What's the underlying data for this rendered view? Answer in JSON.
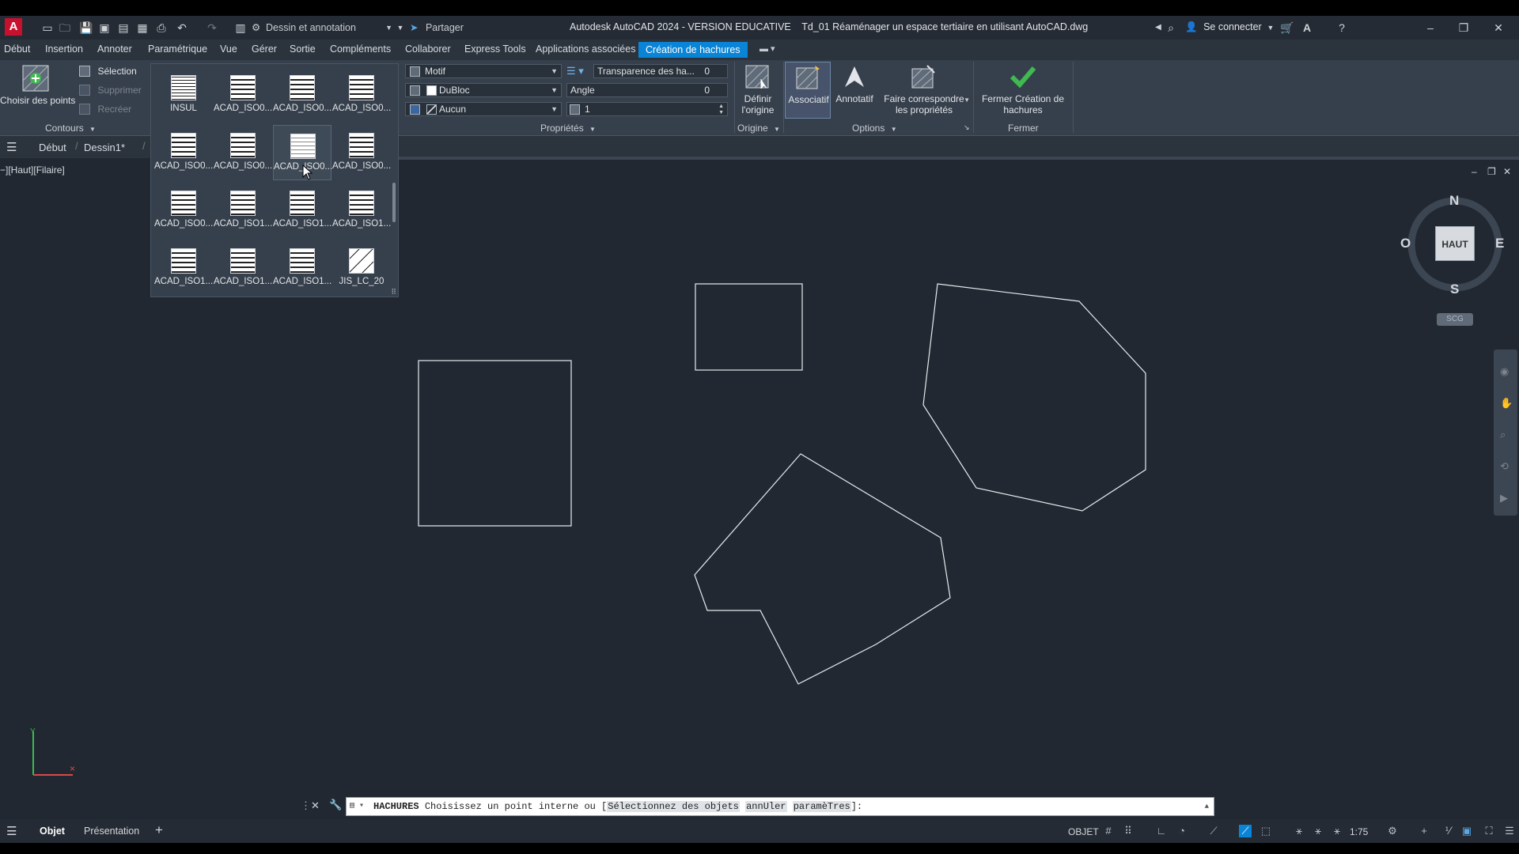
{
  "app": {
    "title": "Autodesk AutoCAD 2024 - VERSION EDUCATIVE",
    "filename": "Td_01 Réaménager un espace tertiaire en utilisant AutoCAD.dwg",
    "logo": "A",
    "workspace": "Dessin et annotation",
    "share_label": "Partager",
    "signin_label": "Se connecter"
  },
  "menu": {
    "items": [
      "Début",
      "Insertion",
      "Annoter",
      "Paramétrique",
      "Vue",
      "Gérer",
      "Sortie",
      "Compléments",
      "Collaborer",
      "Express Tools",
      "Applications associées"
    ],
    "active": "Création de hachures"
  },
  "ribbon": {
    "contours": {
      "pick_points": "Choisir des points",
      "selection": "Sélection",
      "remove": "Supprimer",
      "recreate": "Recréer",
      "title": "Contours"
    },
    "properties": {
      "type_value": "Motif",
      "color_value": "DuBloc",
      "bg_value": "Aucun",
      "transparency_label": "Transparence des ha...",
      "transparency_value": "0",
      "angle_label": "Angle",
      "angle_value": "0",
      "scale_value": "1",
      "title": "Propriétés"
    },
    "origin": {
      "set_origin": "Définir l'origine",
      "title": "Origine"
    },
    "options": {
      "associative": "Associatif",
      "annotative": "Annotatif",
      "match_props": "Faire correspondre les propriétés",
      "title": "Options"
    },
    "close": {
      "label": "Fermer Création de hachures",
      "title": "Fermer"
    }
  },
  "gallery": {
    "patterns": [
      "INSUL",
      "ACAD_ISO0...",
      "ACAD_ISO0...",
      "ACAD_ISO0...",
      "ACAD_ISO0...",
      "ACAD_ISO0...",
      "ACAD_ISO0...",
      "ACAD_ISO0...",
      "ACAD_ISO0...",
      "ACAD_ISO1...",
      "ACAD_ISO1...",
      "ACAD_ISO1...",
      "ACAD_ISO1...",
      "ACAD_ISO1...",
      "ACAD_ISO1...",
      "JIS_LC_20"
    ],
    "selected_index": 6
  },
  "filetabs": {
    "start": "Début",
    "drawing": "Dessin1*"
  },
  "viewport": {
    "label": "−][Haut][Filaire]"
  },
  "viewcube": {
    "north": "N",
    "south": "S",
    "east": "E",
    "west": "O",
    "face": "HAUT",
    "ucs": "SCG"
  },
  "command": {
    "prompt_cmd": "HACHURES",
    "prompt_text": "Choisissez un point interne ou [",
    "opt1": "Sélectionnez des objets",
    "opt2": "annUler",
    "opt3": "paramèTres",
    "prompt_end": "]:"
  },
  "status": {
    "tabs": [
      "Objet",
      "Présentation"
    ],
    "model_label": "OBJET",
    "scale_label": "1:75"
  },
  "colors": {
    "canvas_bg": "#212831",
    "ribbon_bg": "#36404c",
    "accent": "#0a84d6",
    "close_check": "#3fb950"
  }
}
